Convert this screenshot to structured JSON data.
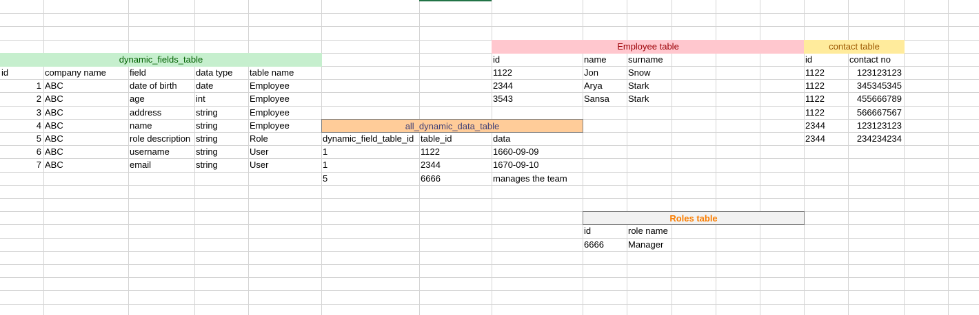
{
  "colors": {
    "grid": "#d4d4d4",
    "active_column": "#217346",
    "dynamic_fields_fill": "#c6efce",
    "dynamic_fields_text": "#006100",
    "employee_fill": "#ffc7ce",
    "employee_text": "#9c0006",
    "contact_fill": "#ffeb9c",
    "contact_text": "#9c5700",
    "all_dynamic_fill": "#ffcc99",
    "all_dynamic_text": "#3f3f76",
    "roles_fill": "#f2f2f2",
    "roles_text": "#fa7d00"
  },
  "dynamic_fields_table": {
    "title": "dynamic_fields_table",
    "headers": [
      "id",
      "company name",
      "field",
      "data type",
      "table name"
    ],
    "rows": [
      {
        "id": "1",
        "company": "ABC",
        "field": "date of birth",
        "type": "date",
        "table": "Employee"
      },
      {
        "id": "2",
        "company": "ABC",
        "field": "age",
        "type": "int",
        "table": "Employee"
      },
      {
        "id": "3",
        "company": "ABC",
        "field": "address",
        "type": "string",
        "table": "Employee"
      },
      {
        "id": "4",
        "company": "ABC",
        "field": "name",
        "type": "string",
        "table": "Employee"
      },
      {
        "id": "5",
        "company": "ABC",
        "field": "role description",
        "type": "string",
        "table": "Role"
      },
      {
        "id": "6",
        "company": "ABC",
        "field": "username",
        "type": "string",
        "table": "User"
      },
      {
        "id": "7",
        "company": "ABC",
        "field": "email",
        "type": "string",
        "table": "User"
      }
    ]
  },
  "employee_table": {
    "title": "Employee table",
    "headers": [
      "id",
      "name",
      "surname"
    ],
    "rows": [
      {
        "id": "1122",
        "name": "Jon",
        "surname": "Snow"
      },
      {
        "id": "2344",
        "name": "Arya",
        "surname": "Stark"
      },
      {
        "id": "3543",
        "name": "Sansa",
        "surname": "Stark"
      }
    ]
  },
  "contact_table": {
    "title": "contact table",
    "headers": [
      "id",
      "contact no"
    ],
    "rows": [
      {
        "id": "1122",
        "contact": "123123123"
      },
      {
        "id": "1122",
        "contact": "345345345"
      },
      {
        "id": "1122",
        "contact": "455666789"
      },
      {
        "id": "1122",
        "contact": "566667567"
      },
      {
        "id": "2344",
        "contact": "123123123"
      },
      {
        "id": "2344",
        "contact": "234234234"
      }
    ]
  },
  "all_dynamic_data_table": {
    "title": "all_dynamic_data_table",
    "headers": [
      "dynamic_field_table_id",
      "table_id",
      "data"
    ],
    "rows": [
      {
        "dfid": "1",
        "tid": "1122",
        "data": "1660-09-09"
      },
      {
        "dfid": "1",
        "tid": "2344",
        "data": "1670-09-10"
      },
      {
        "dfid": "5",
        "tid": "6666",
        "data": "manages the team"
      }
    ]
  },
  "roles_table": {
    "title": "Roles table",
    "headers": [
      "id",
      "role name"
    ],
    "rows": [
      {
        "id": "6666",
        "role": "Manager"
      }
    ]
  }
}
